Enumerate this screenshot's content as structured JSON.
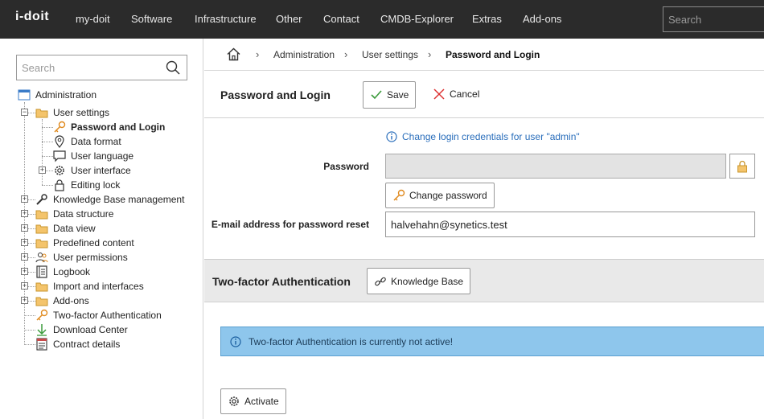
{
  "app": {
    "logo_text": "i-doit"
  },
  "topnav": {
    "items": [
      "my-doit",
      "Software",
      "Infrastructure",
      "Other",
      "Contact",
      "CMDB-Explorer",
      "Extras",
      "Add-ons"
    ],
    "search_placeholder": "Search"
  },
  "sidebar": {
    "search_placeholder": "Search",
    "tree": [
      {
        "label": "Administration",
        "icon": "window-icon"
      },
      {
        "label": "User settings",
        "icon": "folder-icon"
      },
      {
        "label": "Password and Login",
        "icon": "key-icon",
        "active": true
      },
      {
        "label": "Data format",
        "icon": "location-pin-icon"
      },
      {
        "label": "User language",
        "icon": "speech-bubble-icon"
      },
      {
        "label": "User interface",
        "icon": "gear-icon"
      },
      {
        "label": "Editing lock",
        "icon": "lock-icon"
      },
      {
        "label": "Knowledge Base management",
        "icon": "wrench-icon"
      },
      {
        "label": "Data structure",
        "icon": "folder-icon"
      },
      {
        "label": "Data view",
        "icon": "folder-icon"
      },
      {
        "label": "Predefined content",
        "icon": "folder-icon"
      },
      {
        "label": "User permissions",
        "icon": "users-icon"
      },
      {
        "label": "Logbook",
        "icon": "book-icon"
      },
      {
        "label": "Import and interfaces",
        "icon": "folder-icon"
      },
      {
        "label": "Add-ons",
        "icon": "folder-icon"
      },
      {
        "label": "Two-factor Authentication",
        "icon": "key-icon"
      },
      {
        "label": "Download Center",
        "icon": "download-arrow-icon"
      },
      {
        "label": "Contract details",
        "icon": "document-icon"
      }
    ]
  },
  "breadcrumb": [
    "Administration",
    "User settings",
    "Password and Login"
  ],
  "page": {
    "title": "Password and Login",
    "save_label": "Save",
    "cancel_label": "Cancel",
    "info_text": "Change login credentials for user \"admin\"",
    "password_label": "Password",
    "change_password_label": "Change password",
    "email_label": "E-mail address for password reset",
    "email_value": "halvehahn@synetics.test"
  },
  "twofa": {
    "title": "Two-factor Authentication",
    "kb_label": "Knowledge Base",
    "alert_text": "Two-factor Authentication is currently not active!",
    "activate_label": "Activate"
  },
  "colors": {
    "topbar": "#2b2b2b",
    "link": "#2a6ebb",
    "alert_bg": "#8ec6ec",
    "folder": "#f4c46b"
  }
}
